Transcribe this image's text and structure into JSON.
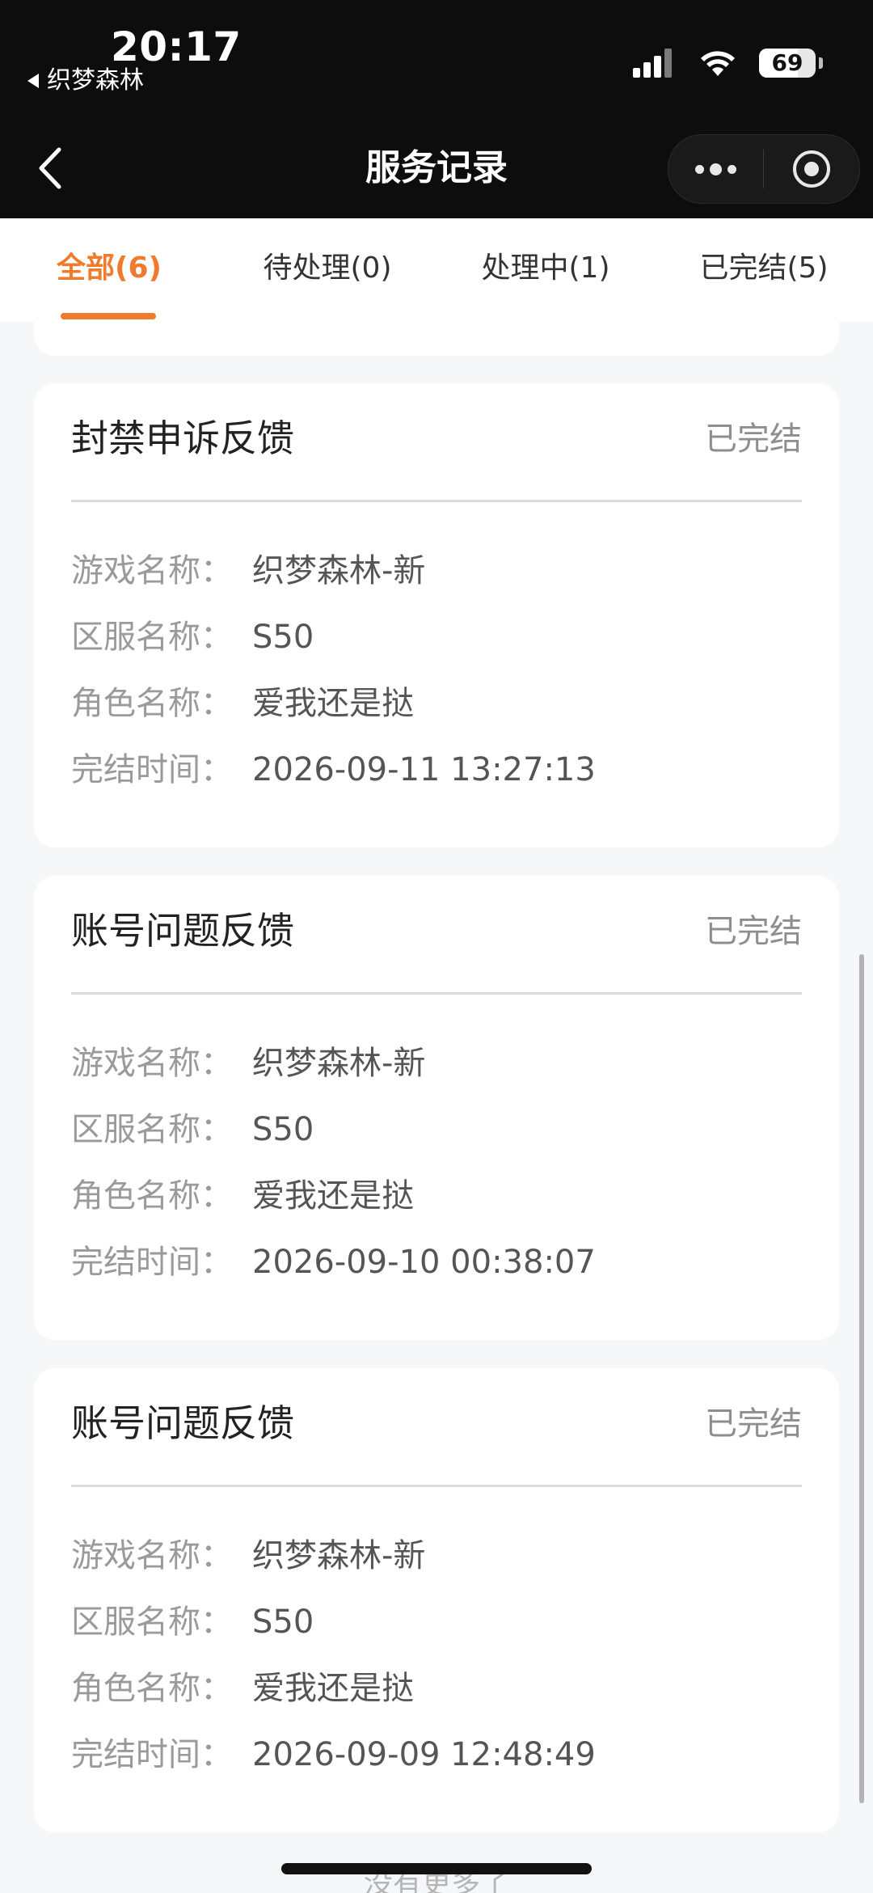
{
  "status_bar": {
    "time": "20:17",
    "back_app": "织梦森林",
    "battery": "69",
    "battery_fraction": 0.69
  },
  "nav": {
    "title": "服务记录"
  },
  "tabs": [
    {
      "label": "全部(6)",
      "active": true
    },
    {
      "label": "待处理(0)",
      "active": false
    },
    {
      "label": "处理中(1)",
      "active": false
    },
    {
      "label": "已完结(5)",
      "active": false
    }
  ],
  "cards": [
    {
      "title": "封禁申诉反馈",
      "status": "已完结",
      "rows": [
        {
          "label": "游戏名称：",
          "value": "织梦森林-新"
        },
        {
          "label": "区服名称：",
          "value": "S50"
        },
        {
          "label": "角色名称：",
          "value": "爱我还是挞"
        },
        {
          "label": "完结时间：",
          "value": "2026-09-11 13:27:13"
        }
      ]
    },
    {
      "title": "账号问题反馈",
      "status": "已完结",
      "rows": [
        {
          "label": "游戏名称：",
          "value": "织梦森林-新"
        },
        {
          "label": "区服名称：",
          "value": "S50"
        },
        {
          "label": "角色名称：",
          "value": "爱我还是挞"
        },
        {
          "label": "完结时间：",
          "value": "2026-09-10 00:38:07"
        }
      ]
    },
    {
      "title": "账号问题反馈",
      "status": "已完结",
      "rows": [
        {
          "label": "游戏名称：",
          "value": "织梦森林-新"
        },
        {
          "label": "区服名称：",
          "value": "S50"
        },
        {
          "label": "角色名称：",
          "value": "爱我还是挞"
        },
        {
          "label": "完结时间：",
          "value": "2026-09-09 12:48:49"
        }
      ]
    }
  ],
  "footer": {
    "no_more": "没有更多了"
  },
  "colors": {
    "accent": "#f07b2d",
    "nav_bg": "#0d0d0d",
    "page_bg": "#f6f7f9"
  }
}
